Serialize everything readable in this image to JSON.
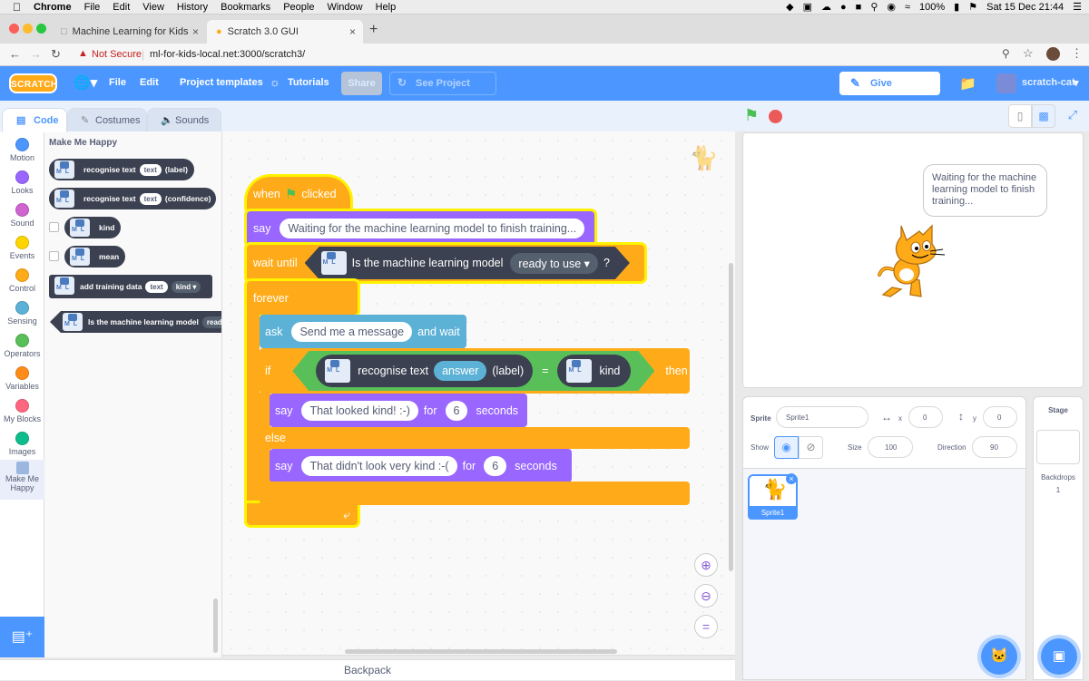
{
  "mac": {
    "app": "Chrome",
    "menus": [
      "File",
      "Edit",
      "View",
      "History",
      "Bookmarks",
      "People",
      "Window",
      "Help"
    ],
    "battery": "100%",
    "clock": "Sat 15 Dec  21:44"
  },
  "browser": {
    "tabs": [
      {
        "title": "Machine Learning for Kids"
      },
      {
        "title": "Scratch 3.0 GUI"
      }
    ],
    "new_tab": "+",
    "not_secure": "Not Secure",
    "url": "ml-for-kids-local.net:3000/scratch3/"
  },
  "menu": {
    "logo": "SCRATCH",
    "file": "File",
    "edit": "Edit",
    "templates": "Project templates",
    "tutorials": "Tutorials",
    "share": "Share",
    "see_page": "See Project Page",
    "feedback": "Give Feedback",
    "user": "scratch-cat"
  },
  "editor_tabs": {
    "code": "Code",
    "costumes": "Costumes",
    "sounds": "Sounds"
  },
  "categories": [
    {
      "label": "Motion",
      "color": "#4c97ff"
    },
    {
      "label": "Looks",
      "color": "#9966ff"
    },
    {
      "label": "Sound",
      "color": "#cf63cf"
    },
    {
      "label": "Events",
      "color": "#ffd500"
    },
    {
      "label": "Control",
      "color": "#ffab19"
    },
    {
      "label": "Sensing",
      "color": "#5cb1d6"
    },
    {
      "label": "Operators",
      "color": "#59c059"
    },
    {
      "label": "Variables",
      "color": "#ff8c1a"
    },
    {
      "label": "My Blocks",
      "color": "#ff6680"
    },
    {
      "label": "Images",
      "color": "#0fbd8c"
    },
    {
      "label": "Make Me Happy",
      "color": "#ffffff"
    }
  ],
  "palette": {
    "title": "Make Me Happy",
    "blocks": {
      "b1": {
        "text": "recognise text",
        "pill": "text",
        "suffix": "(label)"
      },
      "b2": {
        "text": "recognise text",
        "pill": "text",
        "suffix": "(confidence)"
      },
      "b3": {
        "text": "kind"
      },
      "b4": {
        "text": "mean"
      },
      "b5": {
        "text": "add training data",
        "pill": "text",
        "pill2": "kind"
      },
      "b6": {
        "text": "Is the machine learning model",
        "pill": "read"
      }
    }
  },
  "script": {
    "when": "when",
    "clicked": "clicked",
    "say1": "say",
    "say1_text": "Waiting for the machine learning model to finish training...",
    "wait_until": "wait until",
    "is_model": "Is the machine learning model",
    "ready": "ready to use",
    "q": "?",
    "forever": "forever",
    "ask": "ask",
    "ask_text": "Send me a message",
    "and_wait": "and wait",
    "if": "if",
    "recognise": "recognise text",
    "answer": "answer",
    "label": "(label)",
    "eq": "=",
    "kind": "kind",
    "then": "then",
    "say2": "say",
    "say2_text": "That looked kind! :-)",
    "for1": "for",
    "secs1": "6",
    "seconds1": "seconds",
    "else": "else",
    "say3": "say",
    "say3_text": "That didn't look very kind :-(",
    "for2": "for",
    "secs2": "6",
    "seconds2": "seconds"
  },
  "backpack": "Backpack",
  "stage": {
    "bubble": "Waiting for the machine learning model to finish training..."
  },
  "sprite_info": {
    "sprite_label": "Sprite",
    "sprite_name": "Sprite1",
    "x_label": "x",
    "x": "0",
    "y_label": "y",
    "y": "0",
    "show_label": "Show",
    "size_label": "Size",
    "size": "100",
    "direction_label": "Direction",
    "direction": "90",
    "thumb_name": "Sprite1"
  },
  "stage_panel": {
    "title": "Stage",
    "backdrops_label": "Backdrops",
    "backdrops_count": "1"
  }
}
